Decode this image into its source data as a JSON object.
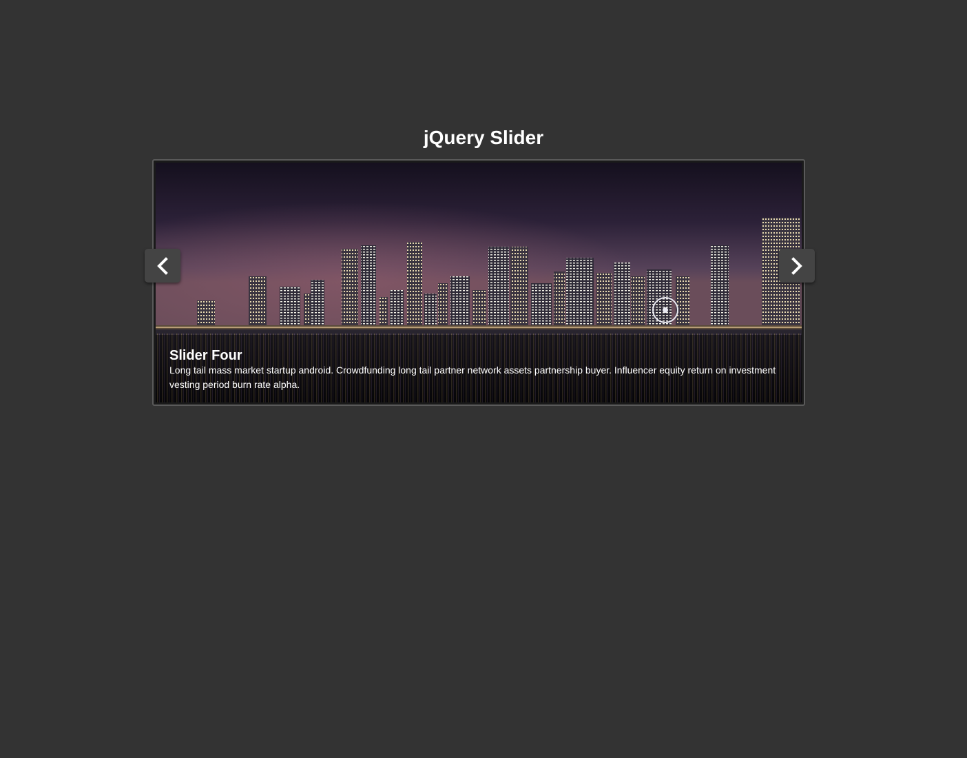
{
  "page": {
    "title": "jQuery Slider"
  },
  "slider": {
    "active_slide": {
      "title": "Slider Four",
      "description": "Long tail mass market startup android. Crowdfunding long tail partner network assets partnership buyer. Influencer equity return on investment vesting period burn rate alpha."
    },
    "prev_icon": "chevron-left-icon",
    "next_icon": "chevron-right-icon"
  },
  "colors": {
    "background": "#333333",
    "frame_border": "#5a5a5a",
    "nav_button": "#444444",
    "text": "#ffffff"
  }
}
